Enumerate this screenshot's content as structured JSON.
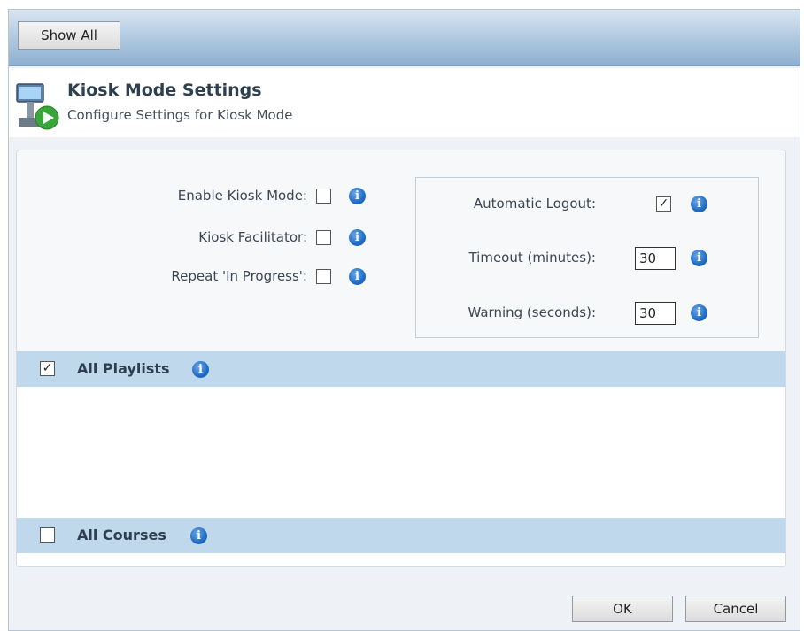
{
  "toolbar": {
    "show_all_label": "Show All"
  },
  "header": {
    "title": "Kiosk Mode Settings",
    "subtitle": "Configure Settings for Kiosk Mode",
    "icon": "kiosk-play-icon"
  },
  "kiosk_options": [
    {
      "label": "Enable Kiosk Mode:",
      "checked": false
    },
    {
      "label": "Kiosk Facilitator:",
      "checked": false
    },
    {
      "label": "Repeat 'In Progress':",
      "checked": false
    }
  ],
  "logout": {
    "automatic_logout_label": "Automatic Logout:",
    "automatic_logout_checked": true,
    "timeout_label": "Timeout (minutes):",
    "timeout_value": "30",
    "warning_label": "Warning (seconds):",
    "warning_value": "30"
  },
  "sections": {
    "playlists": {
      "label": "All Playlists",
      "checked": true
    },
    "courses": {
      "label": "All Courses",
      "checked": false
    }
  },
  "footer": {
    "ok_label": "OK",
    "cancel_label": "Cancel"
  },
  "colors": {
    "toolbar": "#aec7df",
    "section_bar": "#bfd8ec",
    "info_icon": "#1f6cc4"
  },
  "checkmark_glyph": "✓",
  "info_glyph": "i"
}
